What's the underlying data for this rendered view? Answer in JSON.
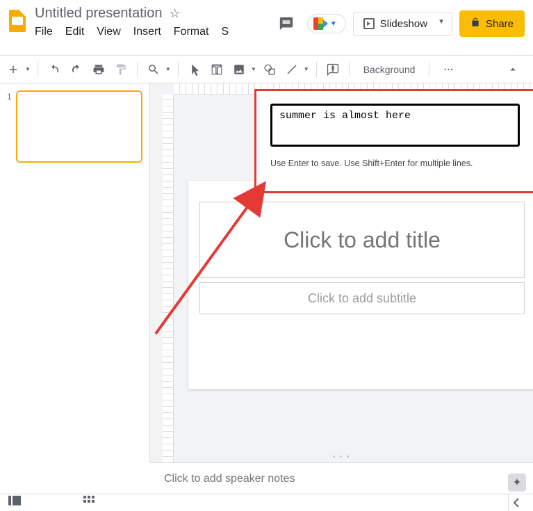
{
  "doc": {
    "title": "Untitled presentation"
  },
  "menus": {
    "file": "File",
    "edit": "Edit",
    "view": "View",
    "insert": "Insert",
    "format": "Format",
    "slide_partial": "S"
  },
  "header": {
    "slideshow": "Slideshow",
    "share": "Share"
  },
  "toolbar": {
    "background": "Background",
    "more": "⋯"
  },
  "callout": {
    "value": "summer is almost here",
    "hint": "Use Enter to save. Use Shift+Enter for multiple lines."
  },
  "slide": {
    "title_placeholder": "Click to add title",
    "subtitle_placeholder": "Click to add subtitle"
  },
  "notes": {
    "placeholder": "Click to add speaker notes"
  },
  "filmstrip": {
    "slide_number": "1"
  }
}
